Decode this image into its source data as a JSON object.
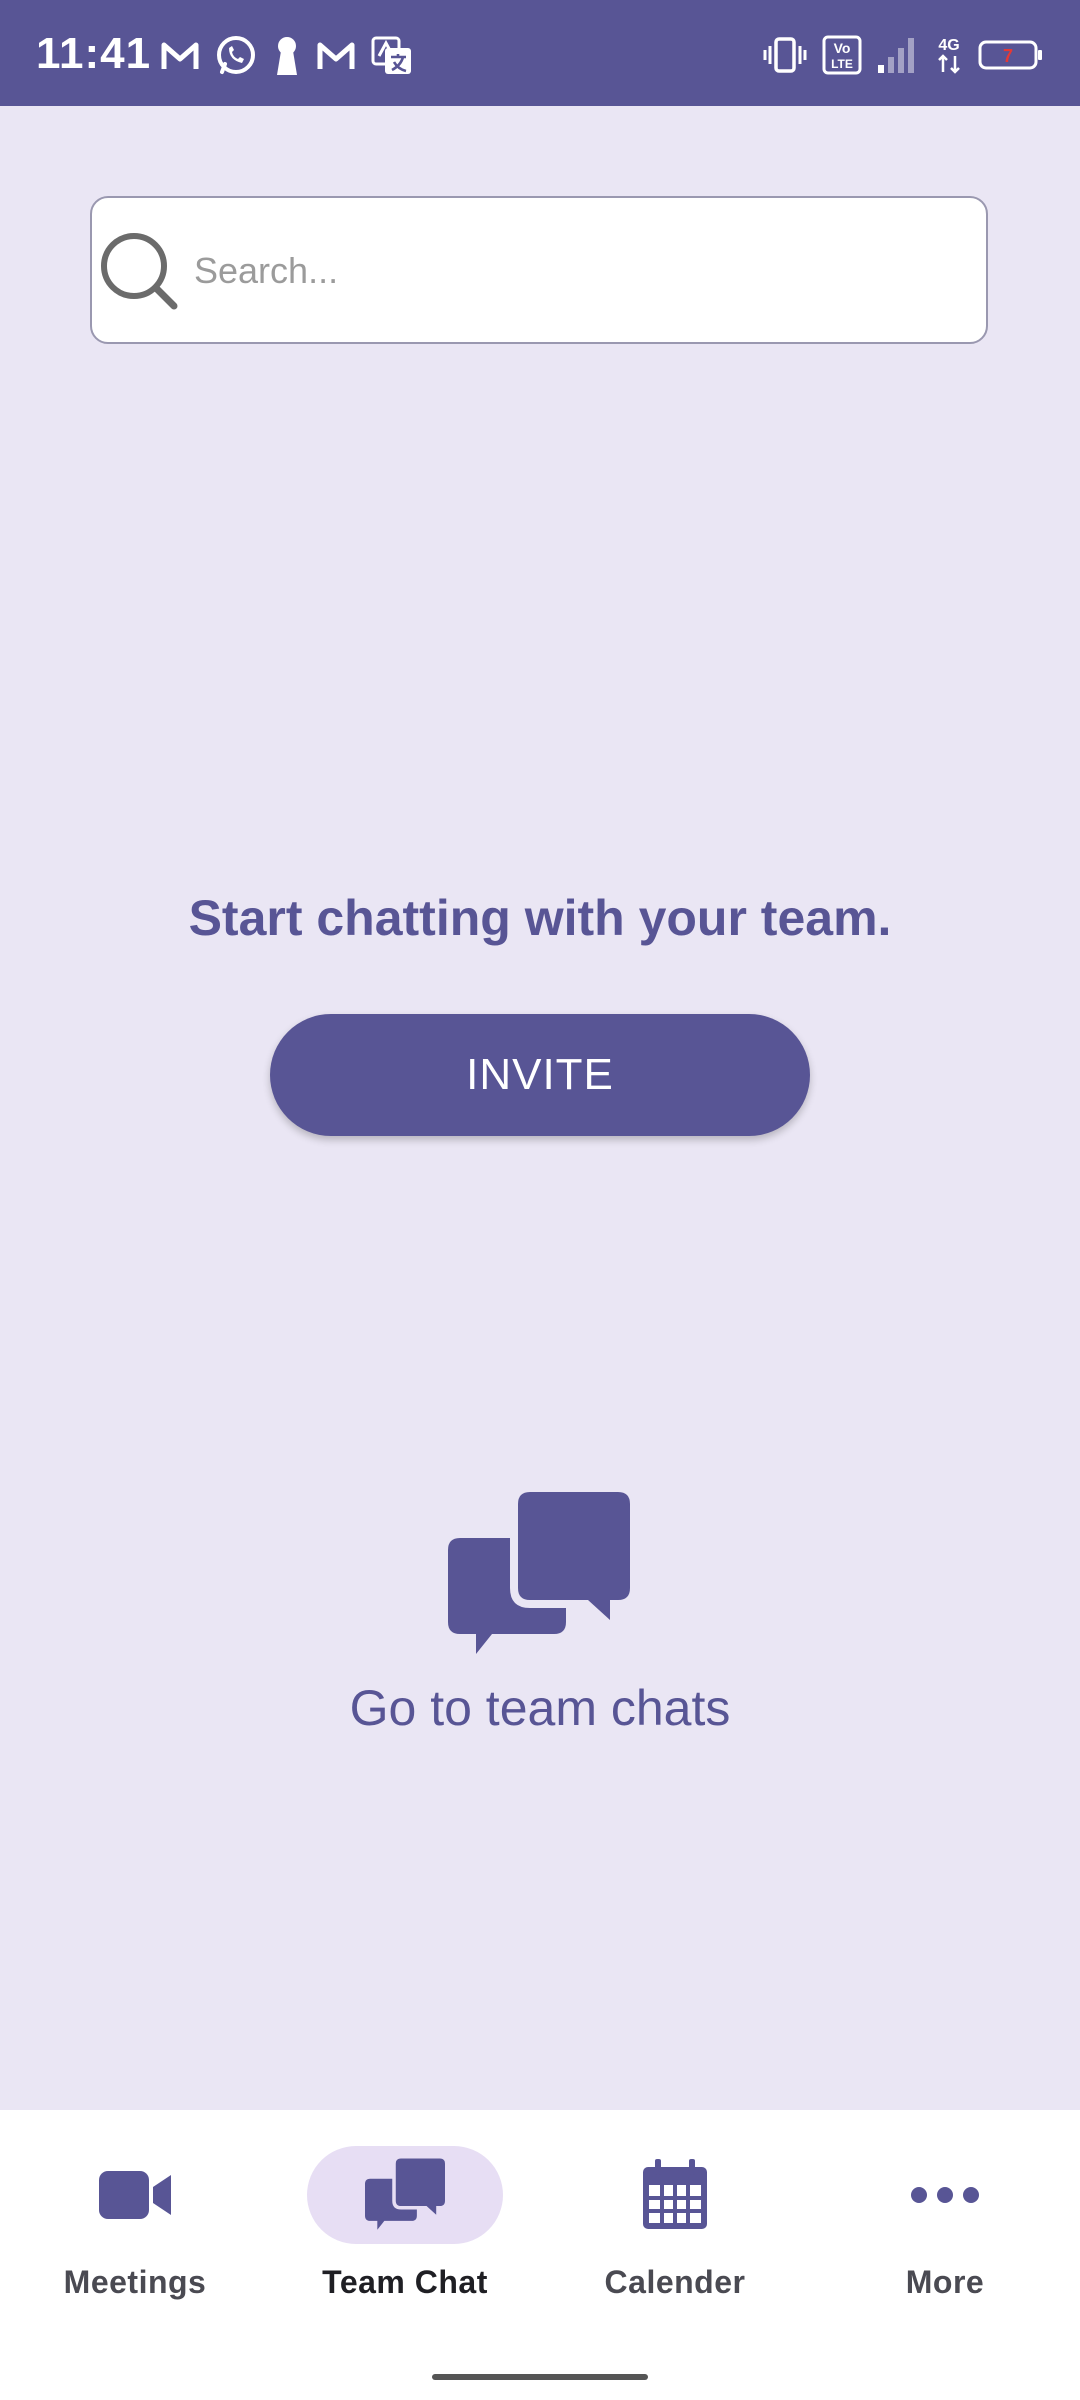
{
  "status_bar": {
    "time": "11:41",
    "notification_icons": [
      "gmail-icon",
      "whatsapp-icon",
      "keyhole-icon",
      "gmail-icon",
      "translate-icon"
    ],
    "system_icons": [
      "vibrate-icon",
      "volte-icon",
      "signal-icon",
      "4g-data-icon",
      "battery-icon"
    ],
    "battery_level": "7"
  },
  "search": {
    "placeholder": "Search..."
  },
  "main": {
    "prompt": "Start chatting with your team.",
    "invite_label": "INVITE",
    "go_to_chats_label": "Go to team chats"
  },
  "bottom_nav": {
    "items": [
      {
        "label": "Meetings",
        "icon": "video-camera-icon"
      },
      {
        "label": "Team Chat",
        "icon": "chat-bubbles-icon",
        "active": true
      },
      {
        "label": "Calender",
        "icon": "calendar-icon"
      },
      {
        "label": "More",
        "icon": "more-dots-icon"
      }
    ]
  },
  "colors": {
    "accent": "#585595",
    "background": "#EAE6F4",
    "active_pill": "#E7DEF4"
  }
}
